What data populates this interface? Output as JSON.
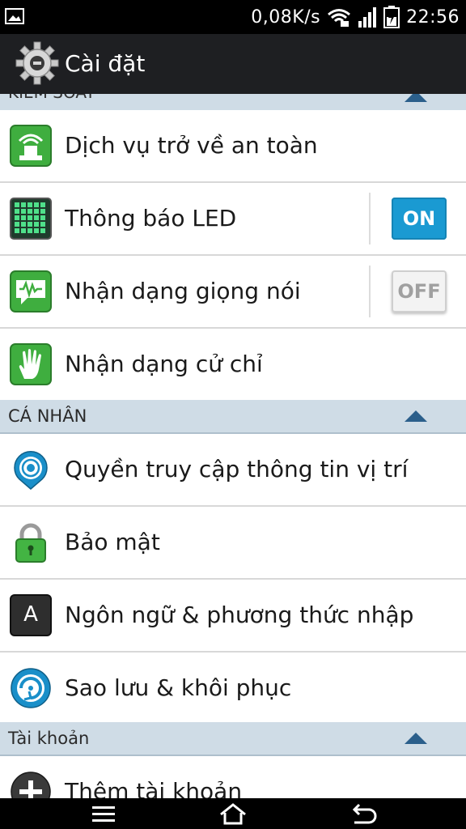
{
  "status_bar": {
    "speed": "0,08K/s",
    "time": "22:56"
  },
  "action_bar": {
    "title": "Cài đặt"
  },
  "top_section": {
    "label": "KIỂM SOÁT"
  },
  "rows_control": [
    {
      "label": "Dịch vụ trở về an toàn"
    },
    {
      "label": "Thông báo LED",
      "toggle": "ON"
    },
    {
      "label": "Nhận dạng giọng nói",
      "toggle": "OFF"
    },
    {
      "label": "Nhận dạng cử chỉ"
    }
  ],
  "section_personal": {
    "label": "CÁ NHÂN"
  },
  "rows_personal": [
    {
      "label": "Quyền truy cập thông tin vị trí"
    },
    {
      "label": "Bảo mật"
    },
    {
      "label": "Ngôn ngữ & phương thức nhập",
      "icon_letter": "A"
    },
    {
      "label": "Sao lưu & khôi phục"
    }
  ],
  "section_accounts": {
    "label": "Tài khoản"
  },
  "rows_accounts": [
    {
      "label": "Thêm tài khoản"
    }
  ],
  "colors": {
    "accent": "#1a9ad2",
    "section_bg": "#cfdce6",
    "actionbar_bg": "#1e1f22"
  }
}
